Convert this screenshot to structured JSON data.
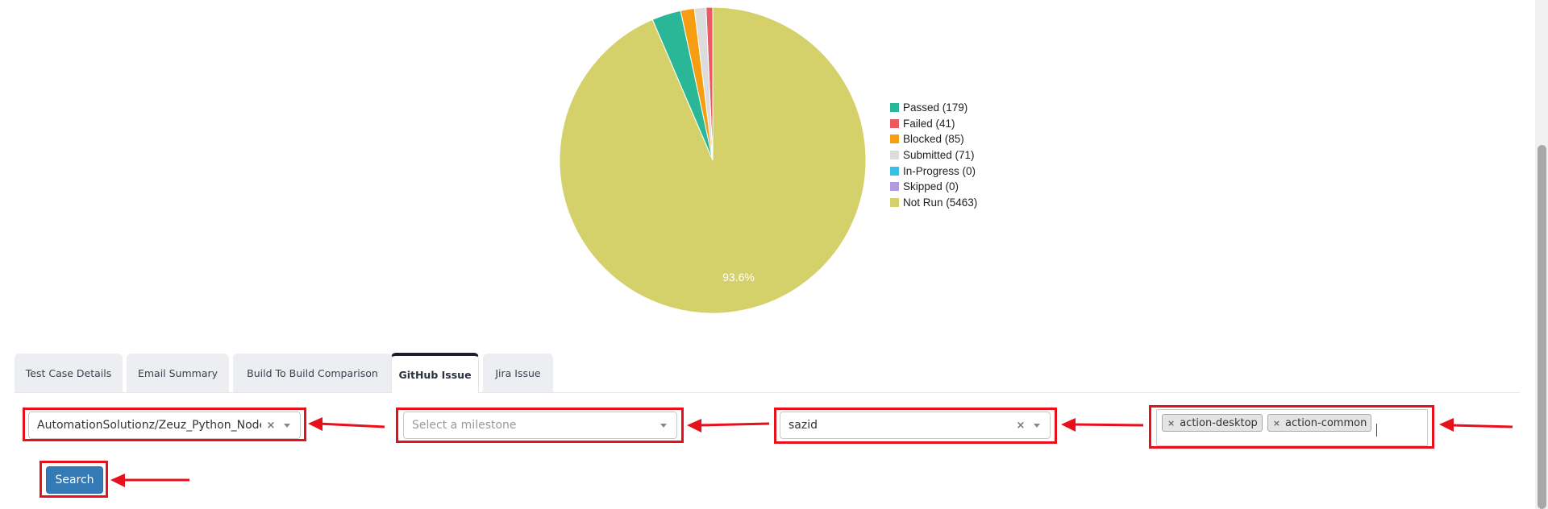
{
  "chart_data": {
    "type": "pie",
    "slices": [
      {
        "label": "Passed",
        "value": 179,
        "color": "#2ab798"
      },
      {
        "label": "Failed",
        "value": 41,
        "color": "#ea5a63"
      },
      {
        "label": "Blocked",
        "value": 85,
        "color": "#f79d11"
      },
      {
        "label": "Submitted",
        "value": 71,
        "color": "#dcdcdc"
      },
      {
        "label": "In-Progress",
        "value": 0,
        "color": "#38bfe8"
      },
      {
        "label": "Skipped",
        "value": 0,
        "color": "#b09ae2"
      },
      {
        "label": "Not Run",
        "value": 5463,
        "color": "#d4d16b"
      }
    ],
    "legend": [
      "Passed (179)",
      "Failed (41)",
      "Blocked (85)",
      "Submitted (71)",
      "In-Progress (0)",
      "Skipped (0)",
      "Not Run (5463)"
    ],
    "data_labels": [
      {
        "slice": "Not Run",
        "text": "93.6%"
      }
    ],
    "legend_position": "right"
  },
  "tabs": [
    {
      "label": "Test Case Details",
      "active": false
    },
    {
      "label": "Email Summary",
      "active": false
    },
    {
      "label": "Build To Build Comparison",
      "active": false
    },
    {
      "label": "GitHub Issue",
      "active": true
    },
    {
      "label": "Jira Issue",
      "active": false
    }
  ],
  "filters": {
    "repository": {
      "value": "AutomationSolutionz/Zeuz_Python_Node",
      "clear_icon": "×"
    },
    "milestone": {
      "placeholder": "Select a milestone"
    },
    "assignee": {
      "value": "sazid",
      "clear_icon": "×"
    },
    "labels": {
      "tags": [
        "action-desktop",
        "action-common"
      ],
      "remove_icon": "×"
    }
  },
  "search_label": "Search",
  "colors": {
    "highlight": "#e8101a",
    "primary_button": "#337ab7"
  }
}
